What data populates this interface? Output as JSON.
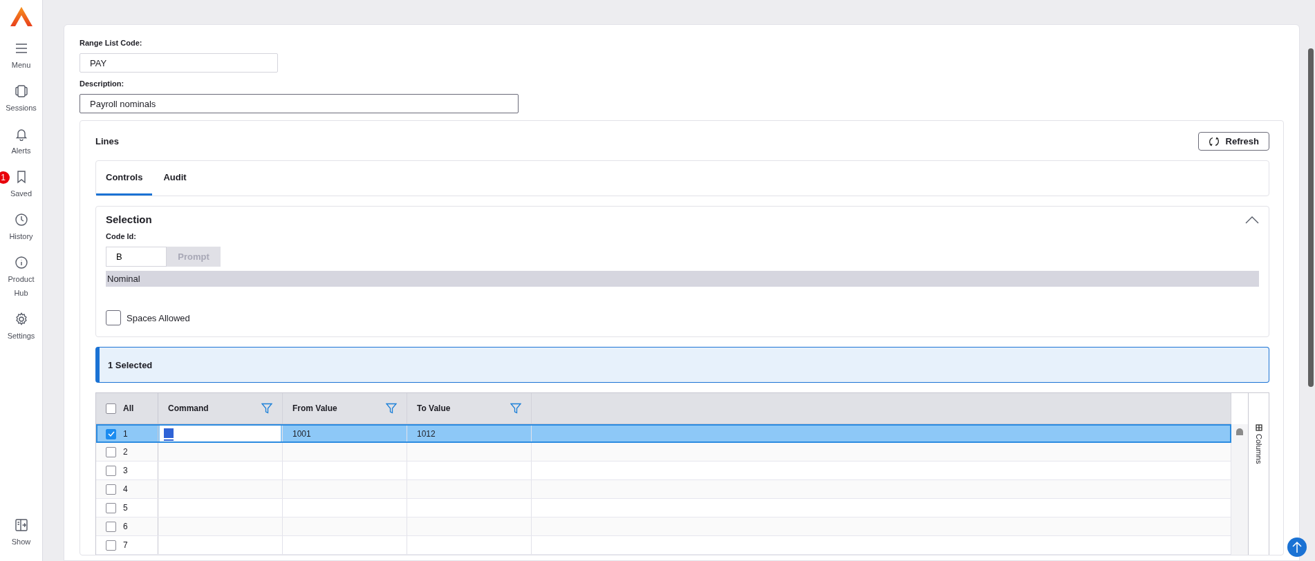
{
  "sidebar": {
    "items": [
      {
        "kind": "menu",
        "label": "Menu"
      },
      {
        "kind": "sessions",
        "label": "Sessions"
      },
      {
        "kind": "alerts",
        "label": "Alerts"
      },
      {
        "kind": "saved",
        "label": "Saved",
        "badge": "1"
      },
      {
        "kind": "history",
        "label": "History"
      },
      {
        "kind": "info",
        "label": "Product Hub"
      },
      {
        "kind": "settings",
        "label": "Settings"
      }
    ],
    "footer": {
      "kind": "show",
      "label": "Show"
    }
  },
  "form": {
    "fields": [
      {
        "label": "Range List Code:",
        "value": "PAY"
      },
      {
        "label": "Description:",
        "value": "Payroll nominals"
      }
    ]
  },
  "lines": {
    "title": "Lines",
    "refresh_button": "Refresh",
    "tabs": [
      {
        "label": "Controls",
        "selected": true
      },
      {
        "label": "Audit",
        "selected": false
      }
    ],
    "selection": {
      "title": "Selection",
      "expanded": true,
      "code_label": "Code Id:",
      "code_value": "B",
      "prompt_button": {
        "label": "Prompt",
        "disabled": true
      },
      "code_description": "Nominal",
      "checkbox": {
        "label": "Spaces Allowed",
        "checked": false
      }
    },
    "banner": "1 Selected",
    "grid": {
      "select_all": {
        "label": "All",
        "checked": false
      },
      "columns": [
        "Command",
        "From Value",
        "To Value"
      ],
      "side_panel": "Columns",
      "rows": [
        {
          "number": "1",
          "selected": true,
          "editing": true,
          "from": "1001",
          "to": "1012"
        },
        {
          "number": "2",
          "selected": false
        },
        {
          "number": "3",
          "selected": false
        },
        {
          "number": "4",
          "selected": false
        },
        {
          "number": "5",
          "selected": false
        },
        {
          "number": "6",
          "selected": false
        },
        {
          "number": "7",
          "selected": false
        }
      ]
    }
  }
}
